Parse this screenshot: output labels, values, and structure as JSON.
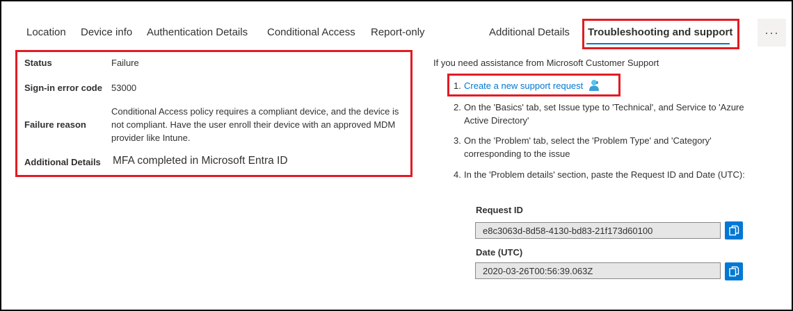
{
  "tabs": [
    {
      "label": "Location"
    },
    {
      "label": "Device info"
    },
    {
      "label": "Authentication Details"
    },
    {
      "label": "Conditional Access"
    },
    {
      "label": "Report-only"
    },
    {
      "label": "Additional Details"
    },
    {
      "label": "Troubleshooting and support",
      "active": true
    }
  ],
  "more_label": "···",
  "details": {
    "status_label": "Status",
    "status_value": "Failure",
    "error_code_label": "Sign-in error code",
    "error_code_value": "53000",
    "failure_reason_label": "Failure reason",
    "failure_reason_value": "Conditional Access policy requires a compliant device, and the device is not compliant. Have the user enroll their device with an approved MDM provider like Intune.",
    "additional_label": "Additional Details",
    "additional_value": "MFA completed in Microsoft Entra ID"
  },
  "support": {
    "intro": "If you need assistance from Microsoft Customer Support",
    "steps": [
      {
        "num": "1.",
        "text": "Create a new support request"
      },
      {
        "num": "2.",
        "text": "On the 'Basics' tab, set Issue type to 'Technical', and Service to 'Azure Active Directory'"
      },
      {
        "num": "3.",
        "text": "On the 'Problem' tab, select the 'Problem Type' and 'Category' corresponding to the issue"
      },
      {
        "num": "4.",
        "text": "In the 'Problem details' section, paste the Request ID and Date (UTC):"
      }
    ],
    "request_id_label": "Request ID",
    "request_id_value": "e8c3063d-8d58-4130-bd83-21f173d60100",
    "date_label": "Date (UTC)",
    "date_value": "2020-03-26T00:56:39.063Z"
  },
  "colors": {
    "accent": "#0078d4",
    "highlight": "#e21b23",
    "field_bg": "#e6e6e6"
  }
}
